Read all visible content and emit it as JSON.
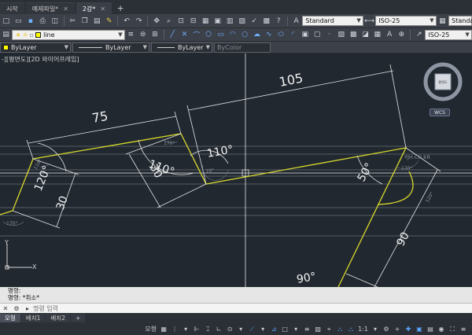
{
  "title_tabs": [
    {
      "label": "시작",
      "active": false
    },
    {
      "label": "예제파일*",
      "active": false
    },
    {
      "label": "2강*",
      "active": true
    }
  ],
  "styles": {
    "text_style": "Standard",
    "dim_style": "ISO-25",
    "table_style": "Standa",
    "multileader_style": "ISO-25"
  },
  "layer": {
    "current": "line",
    "color_combo": "ByLayer",
    "linetype_combo": "ByLayer",
    "lineweight_combo": "ByLayer",
    "plotstyle_combo": "ByColor"
  },
  "viewport": {
    "label": "-][평면도][2D 와이어프레임]",
    "navcube_face": "평면도",
    "wcs": "WCS",
    "watermark": "YJH.CO.KR",
    "ucs_y": "Y",
    "ucs_x": "X"
  },
  "dimensions": {
    "d75": "75",
    "d105": "105",
    "d30a": "30",
    "d30b": "30",
    "d90": "90",
    "a110a": "110°",
    "a110b": "110°",
    "a120": "120°",
    "a50": "50°",
    "a90": "90°",
    "g110": "110°",
    "g170a": "170°",
    "g170b": "170°",
    "g170c": "170°",
    "g120": "120°",
    "g70": "70°"
  },
  "command": {
    "history1": "명령:",
    "history2": "명령: *취소*",
    "placeholder": "명령 입력"
  },
  "layout_tabs": [
    {
      "label": "모형",
      "active": true
    },
    {
      "label": "배치1",
      "active": false
    },
    {
      "label": "배치2",
      "active": false
    }
  ],
  "status": {
    "model": "모형",
    "scale": "1:1"
  }
}
